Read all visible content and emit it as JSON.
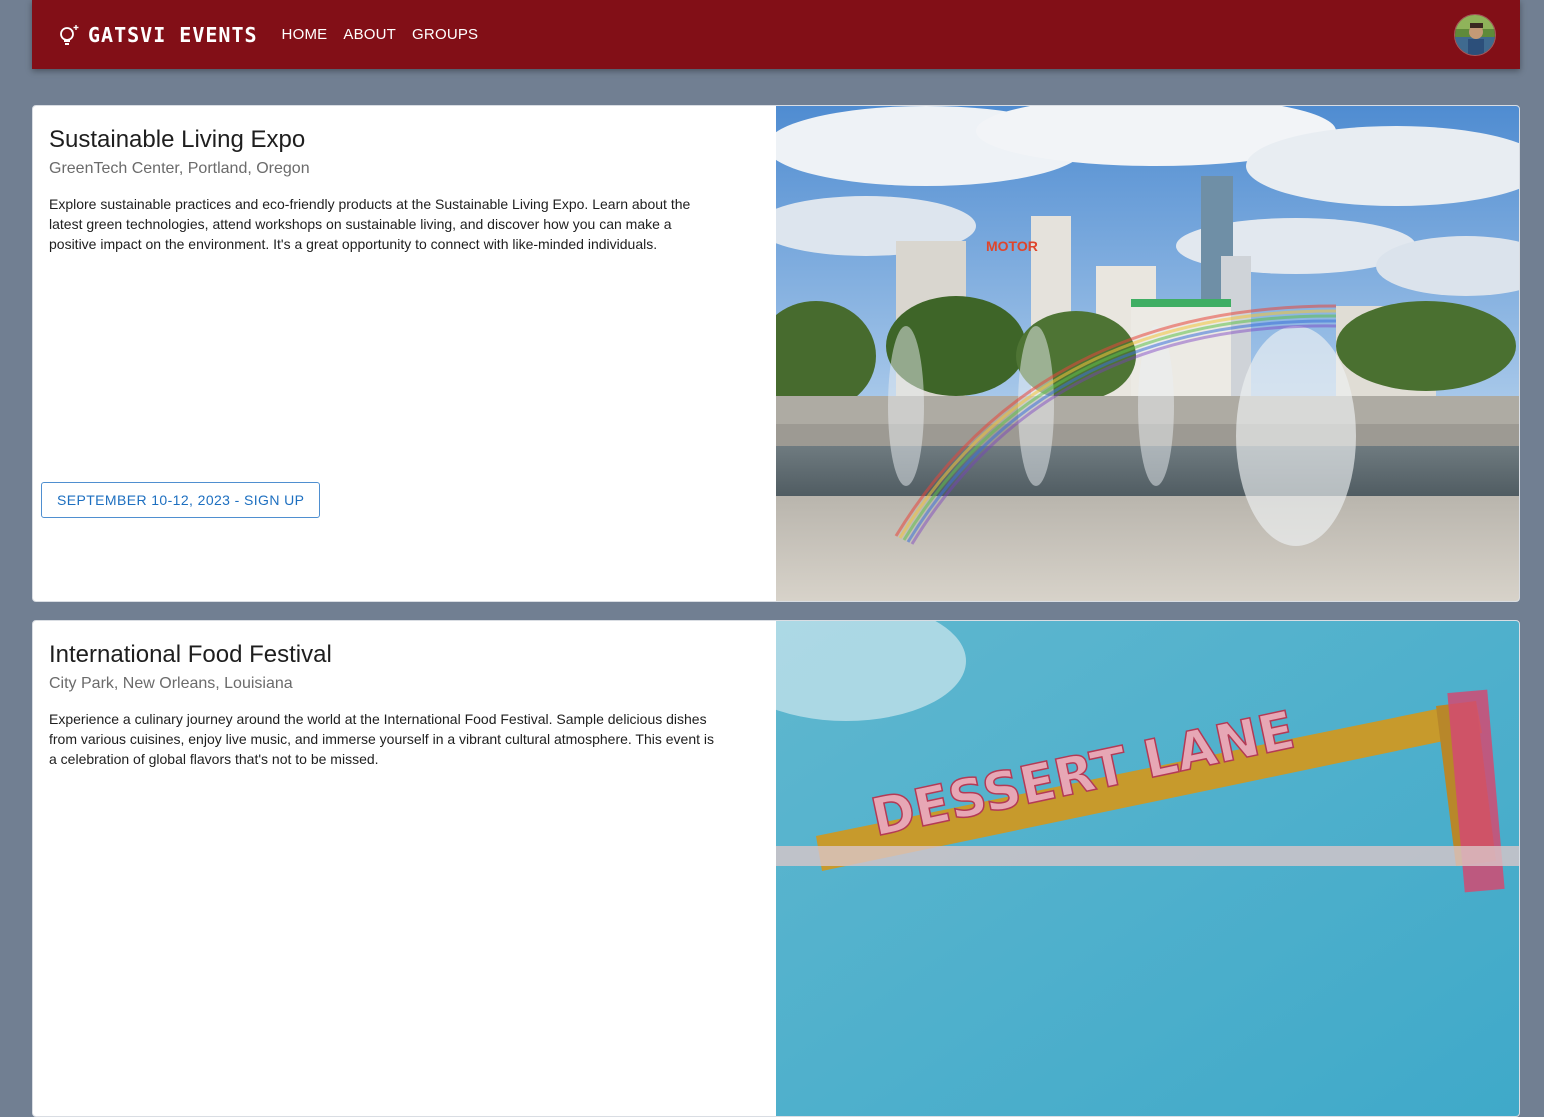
{
  "header": {
    "brand": "GATSVI EVENTS",
    "brand_icon": "lightbulb-icon",
    "nav": [
      {
        "label": "HOME"
      },
      {
        "label": "ABOUT"
      },
      {
        "label": "GROUPS"
      }
    ],
    "avatar_icon": "user-avatar"
  },
  "events": [
    {
      "title": "Sustainable Living Expo",
      "location": "GreenTech Center, Portland, Oregon",
      "description": "Explore sustainable practices and eco-friendly products at the Sustainable Living Expo. Learn about the latest green technologies, attend workshops on sustainable living, and discover how you can make a positive impact on the environment. It's a great opportunity to connect with like-minded individuals.",
      "button": "SEPTEMBER 10-12, 2023 - SIGN UP",
      "image_alt": "Fountains with a rainbow in front of city buildings"
    },
    {
      "title": "International Food Festival",
      "location": "City Park, New Orleans, Louisiana",
      "description": "Experience a culinary journey around the world at the International Food Festival. Sample delicious dishes from various cuisines, enjoy live music, and immerse yourself in a vibrant cultural atmosphere. This event is a celebration of global flavors that's not to be missed.",
      "image_sign_text": "DESSERT LANE"
    }
  ],
  "colors": {
    "appbar": "#820f17",
    "background": "#717f92",
    "button_text": "#1d6fc0"
  }
}
